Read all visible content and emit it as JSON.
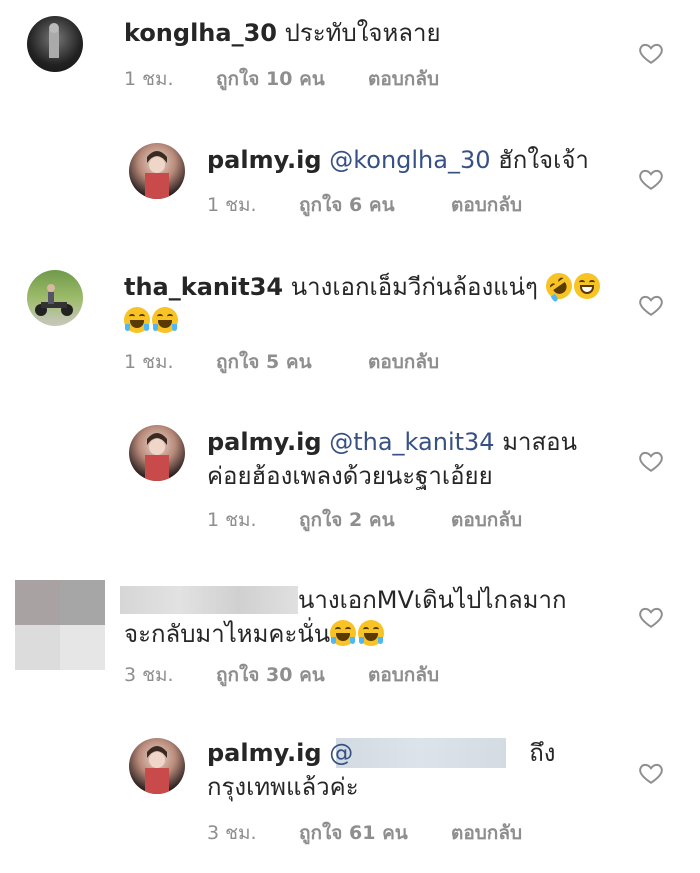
{
  "comments": [
    {
      "username": "konglha_30",
      "text": "ประทับใจหลาย",
      "time": "1 ชม.",
      "likes": "ถูกใจ 10 คน",
      "reply": "ตอบกลับ"
    },
    {
      "username": "palmy.ig",
      "mention": "@konglha_30",
      "text": "ฮักใจเจ้า",
      "time": "1 ชม.",
      "likes": "ถูกใจ 6 คน",
      "reply": "ตอบกลับ"
    },
    {
      "username": "tha_kanit34",
      "text": "นางเอกเอ็มวีก่นล้องแน่ๆ",
      "time": "1 ชม.",
      "likes": "ถูกใจ 5 คน",
      "reply": "ตอบกลับ"
    },
    {
      "username": "palmy.ig",
      "mention": "@tha_kanit34",
      "text_line1": "มาสอน",
      "text_line2": "ค่อยฮ้องเพลงด้วยนะฐาเอ้ยย",
      "time": "1 ชม.",
      "likes": "ถูกใจ 2 คน",
      "reply": "ตอบกลับ"
    },
    {
      "text_line1": "นางเอกMVเดินไปไกลมาก",
      "text_line2": "จะกลับมาไหมคะนั่น",
      "time": "3 ชม.",
      "likes": "ถูกใจ 30 คน",
      "reply": "ตอบกลับ"
    },
    {
      "username": "palmy.ig",
      "mention": "@",
      "text_line1": "ถึง",
      "text_line2": "กรุงเทพแล้วค่ะ",
      "time": "3 ชม.",
      "likes": "ถูกใจ 61 คน",
      "reply": "ตอบกลับ"
    }
  ],
  "icons": {
    "heart": "heart-outline-icon",
    "emoji_rofl": "rolling-on-floor-laughing-emoji",
    "emoji_grin": "grinning-face-emoji",
    "emoji_joy": "face-with-tears-of-joy-emoji"
  },
  "colors": {
    "text": "#262626",
    "meta": "#8e8e8e",
    "mention": "#385185"
  }
}
